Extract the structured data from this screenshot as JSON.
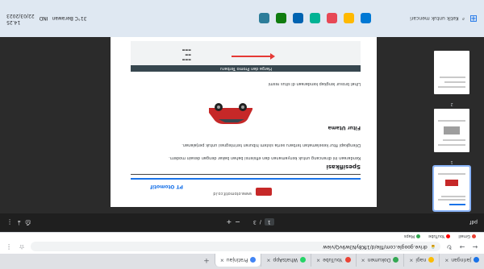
{
  "browser": {
    "tabs": [
      {
        "label": "Jaringan",
        "color": "#1a73e8",
        "active": false
      },
      {
        "label": "nagi",
        "color": "#fbbc04",
        "active": false
      },
      {
        "label": "Dokumen",
        "color": "#34a853",
        "active": false
      },
      {
        "label": "YouTube",
        "color": "#ea4335",
        "active": false
      },
      {
        "label": "WhatsApp",
        "color": "#25d366",
        "active": false
      },
      {
        "label": "Pratinjau",
        "color": "#4285f4",
        "active": true
      }
    ],
    "new_tab": "+",
    "address": "drive.google.com/file/d/1fK8yN3w9vQ/view",
    "bookmarks": [
      {
        "label": "Gmail",
        "color": "#ea4335"
      },
      {
        "label": "YouTube",
        "color": "#ff0000"
      },
      {
        "label": "Maps",
        "color": "#34a853"
      }
    ]
  },
  "viewer": {
    "filename": "pdf",
    "page_current": "1",
    "page_sep": "/",
    "page_total": "3",
    "zoom_out": "−",
    "zoom_in": "+"
  },
  "document": {
    "company": "PT Otomotif",
    "meta": "www.otomotif.co.id",
    "heading": "Spesifikasi",
    "para1": "Kendaraan ini dirancang untuk kenyamanan dan efisiensi bahan bakar dengan desain modern.",
    "para2": "Dilengkapi fitur keselamatan terbaru serta sistem hiburan terintegrasi untuk perjalanan.",
    "subheading": "Fitur Utama",
    "link": "Lihat brosur lengkap kendaraan di situs resmi",
    "banner_title": "Harga dan Promo Terbaru"
  },
  "taskbar": {
    "search_placeholder": "Ketik untuk mencari",
    "weather": "31°C Berawan",
    "language": "IND",
    "time": "14.25",
    "date": "22/03/2023",
    "apps": [
      "#0078d4",
      "#ffb900",
      "#e74856",
      "#00b294",
      "#0063b1",
      "#107c10",
      "#2d7d9a"
    ]
  },
  "icons": {
    "back": "←",
    "forward": "→",
    "reload": "↻",
    "lock": "🔒",
    "star": "☆",
    "download": "⤓",
    "print": "⎙",
    "more": "⋮",
    "windows": "⊞",
    "search": "⌕"
  }
}
